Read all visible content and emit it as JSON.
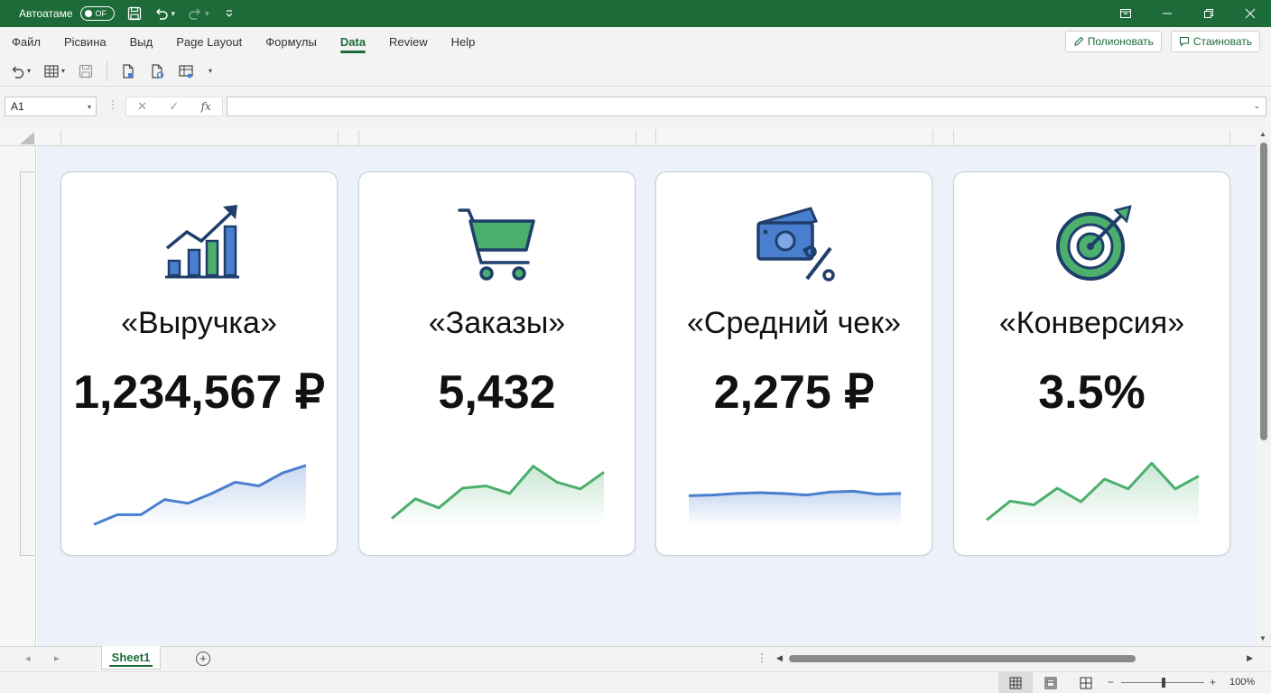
{
  "titlebar": {
    "autosave_label": "Автоатаме",
    "toggle_state": "OF"
  },
  "menu": {
    "items": [
      "Файл",
      "Рісвина",
      "Выд",
      "Page Layout",
      "Формулы",
      "Data",
      "Review",
      "Help"
    ],
    "active": "Data",
    "right_buttons": [
      "Полионовать",
      "Стаиновать"
    ]
  },
  "formula_bar": {
    "name_box": "A1",
    "fx": "fx",
    "formula": ""
  },
  "cards": [
    {
      "title": "«Выручка»",
      "value": "1,234,567 ₽",
      "icon": "bar-chart-growth-icon"
    },
    {
      "title": "«Заказы»",
      "value": "5,432",
      "icon": "shopping-cart-icon"
    },
    {
      "title": "«Средний чек»",
      "value": "2,275 ₽",
      "icon": "money-percent-icon"
    },
    {
      "title": "«Конверсия»",
      "value": "3.5%",
      "icon": "target-icon"
    }
  ],
  "sparklines": [
    {
      "color": "#4a7fcf",
      "values": [
        2,
        15,
        15,
        35,
        30,
        43,
        58,
        53,
        70,
        80
      ]
    },
    {
      "color": "#4caf6e",
      "values": [
        10,
        36,
        24,
        50,
        53,
        43,
        79,
        58,
        49,
        71
      ]
    },
    {
      "color": "#4a7fcf",
      "values": [
        40,
        41,
        43,
        44,
        43,
        41,
        45,
        46,
        42,
        43
      ]
    },
    {
      "color": "#4caf6e",
      "values": [
        8,
        33,
        28,
        50,
        32,
        62,
        49,
        83,
        49,
        66
      ]
    }
  ],
  "sheets": {
    "tabs": [
      "Sheet1"
    ],
    "active": "Sheet1"
  },
  "status": {
    "zoom": "100%",
    "zoom_minus": "−",
    "zoom_plus": "+"
  },
  "colors": {
    "accent": "#1e6b3a",
    "blue": "#4a7fcf",
    "green": "#4caf6e"
  }
}
